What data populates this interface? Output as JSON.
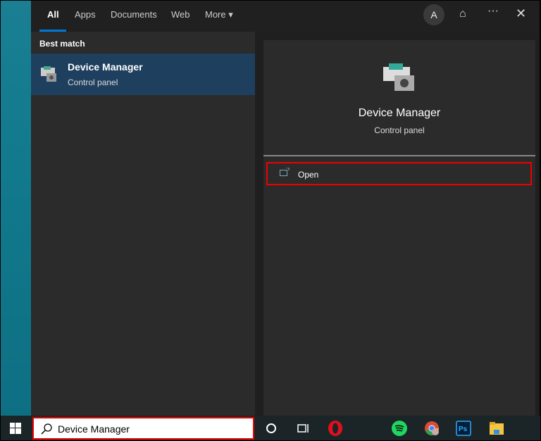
{
  "header": {
    "tabs": [
      {
        "label": "All"
      },
      {
        "label": "Apps"
      },
      {
        "label": "Documents"
      },
      {
        "label": "Web"
      },
      {
        "label": "More ▾"
      }
    ],
    "avatar": "A"
  },
  "results": {
    "section": "Best match",
    "items": [
      {
        "title": "Device Manager",
        "subtitle": "Control panel"
      }
    ]
  },
  "detail": {
    "title": "Device Manager",
    "subtitle": "Control panel",
    "actions": [
      {
        "label": "Open"
      }
    ]
  },
  "taskbar": {
    "search_value": "Device Manager"
  }
}
